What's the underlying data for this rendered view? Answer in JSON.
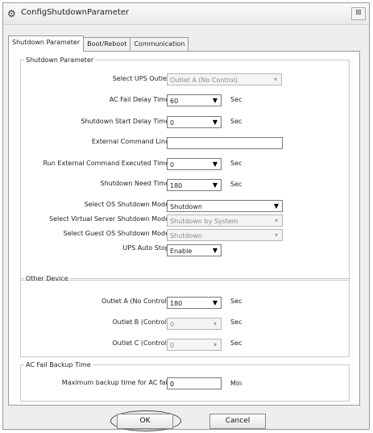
{
  "window": {
    "title": "ConfigShutdownParameter",
    "close": "⊠"
  },
  "tabs": [
    "Shutdown Parameter",
    "Boot/Reboot",
    "Communication"
  ],
  "shutdown": {
    "legend": "Shutdown Parameter",
    "ups_outlet": {
      "label": "Select UPS Outlet",
      "value": "Outlet A (No Control)"
    },
    "ac_fail_delay": {
      "label": "AC Fail Delay Time",
      "value": "60",
      "unit": "Sec"
    },
    "start_delay": {
      "label": "Shutdown Start Delay Time",
      "value": "0",
      "unit": "Sec"
    },
    "ext_cmd": {
      "label": "External Command Line",
      "value": ""
    },
    "ext_cmd_time": {
      "label": "Run External Command Executed Time",
      "value": "0",
      "unit": "Sec"
    },
    "need_time": {
      "label": "Shutdown Need Time",
      "value": "180",
      "unit": "Sec"
    },
    "os_mode": {
      "label": "Select OS Shutdown Mode",
      "value": "Shutdown"
    },
    "vs_mode": {
      "label": "Select Virtual Server Shutdown Mode",
      "value": "Shutdown by System"
    },
    "guest_mode": {
      "label": "Select Guest OS Shutdown Mode",
      "value": "Shutdown"
    },
    "auto_stop": {
      "label": "UPS Auto Stop",
      "value": "Enable"
    }
  },
  "other": {
    "legend": "Other Device",
    "outlet_a": {
      "label": "Outlet A (No Control)",
      "value": "180",
      "unit": "Sec"
    },
    "outlet_b": {
      "label": "Outlet B (Control)",
      "value": "0",
      "unit": "Sec"
    },
    "outlet_c": {
      "label": "Outlet C (Control)",
      "value": "0",
      "unit": "Sec"
    }
  },
  "backup": {
    "legend": "AC Fail Backup Time",
    "max": {
      "label": "Maximum backup time for AC fail",
      "value": "0",
      "unit": "Min"
    }
  },
  "buttons": {
    "ok": "OK",
    "cancel": "Cancel"
  }
}
